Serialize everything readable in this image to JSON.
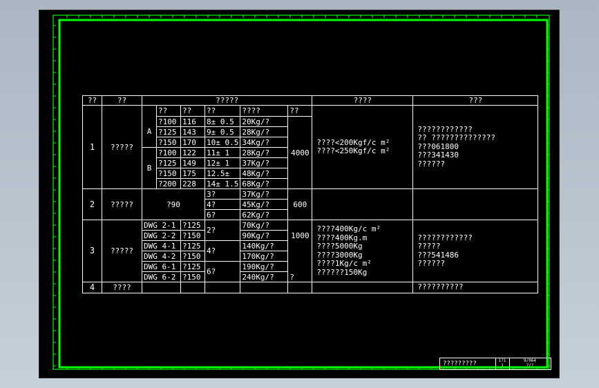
{
  "header": {
    "no": "??",
    "name": "??",
    "spec": "?????",
    "load": "????",
    "source": "???"
  },
  "subheader": {
    "type": "??",
    "dia": "??",
    "thick": "??",
    "weight": "????",
    "length": "??"
  },
  "row1": {
    "no": "1",
    "name": "?????",
    "group_a": "A",
    "group_b": "B",
    "length": "4000",
    "load_lines": [
      "????<200Kgf/c m²",
      "????<250Kgf/c m²"
    ],
    "source_lines": [
      "????????????",
      "??  ??????????????",
      "???061800",
      "???341430",
      "??????"
    ],
    "specs": [
      {
        "type": "?100",
        "dia": "116",
        "thick": "8± 0.5",
        "weight": "20Kg/?"
      },
      {
        "type": "?125",
        "dia": "143",
        "thick": "9± 0.5",
        "weight": "28Kg/?"
      },
      {
        "type": "?150",
        "dia": "170",
        "thick": "10± 0.5",
        "weight": "34Kg/?"
      },
      {
        "type": "?100",
        "dia": "122",
        "thick": "11± 1",
        "weight": "28Kg/?"
      },
      {
        "type": "?125",
        "dia": "149",
        "thick": "12± 1",
        "weight": "37Kg/?"
      },
      {
        "type": "?150",
        "dia": "175",
        "thick": "12.5±",
        "weight": "48Kg/?"
      },
      {
        "type": "?200",
        "dia": "228",
        "thick": "14± 1.5",
        "weight": "68Kg/?"
      }
    ]
  },
  "row2": {
    "no": "2",
    "name": "?????",
    "type": "?90",
    "length": "600",
    "specs": [
      {
        "thick": "3?",
        "weight": "37Kg/?"
      },
      {
        "thick": "4?",
        "weight": "45Kg/?"
      },
      {
        "thick": "6?",
        "weight": "62Kg/?"
      }
    ]
  },
  "row3": {
    "no": "3",
    "name": "?????",
    "length_top": "1000",
    "length_bottom": "?",
    "load_lines": [
      "????400Kg/c m²",
      "????400Kg.m",
      "????5000Kg",
      "????3000Kg",
      "????1Kg/c m²",
      "??????150Kg"
    ],
    "source_lines": [
      "????????????",
      "?????",
      "???541486",
      "??????"
    ],
    "specs": [
      {
        "dwg": "DWG 2-1",
        "type": "?125",
        "thick": "2?",
        "weight": "70Kg/?"
      },
      {
        "dwg": "DWG 2-2",
        "type": "?150",
        "weight": "90Kg/?"
      },
      {
        "dwg": "DWG 4-1",
        "type": "?125",
        "thick": "4?",
        "weight": "140Kg/?"
      },
      {
        "dwg": "DWG 4-2",
        "type": "?150",
        "weight": "170Kg/?"
      },
      {
        "dwg": "DWG 6-1",
        "type": "?125",
        "thick": "6?",
        "weight": "190Kg/?"
      },
      {
        "dwg": "DWG 6-2",
        "type": "?150",
        "weight": "240Kg/?"
      }
    ]
  },
  "row4": {
    "no": "4",
    "name": "????",
    "source": "??????????"
  },
  "title_block": {
    "name": "?????????",
    "v1_top": "1?1",
    "v1_bottom": "1",
    "v2_top": "9/064",
    "v2_bottom": "?/?"
  },
  "colors": {
    "frame": "#00ff00",
    "background": "#000000",
    "text": "#ffffff",
    "window": "#b8c4cf"
  }
}
